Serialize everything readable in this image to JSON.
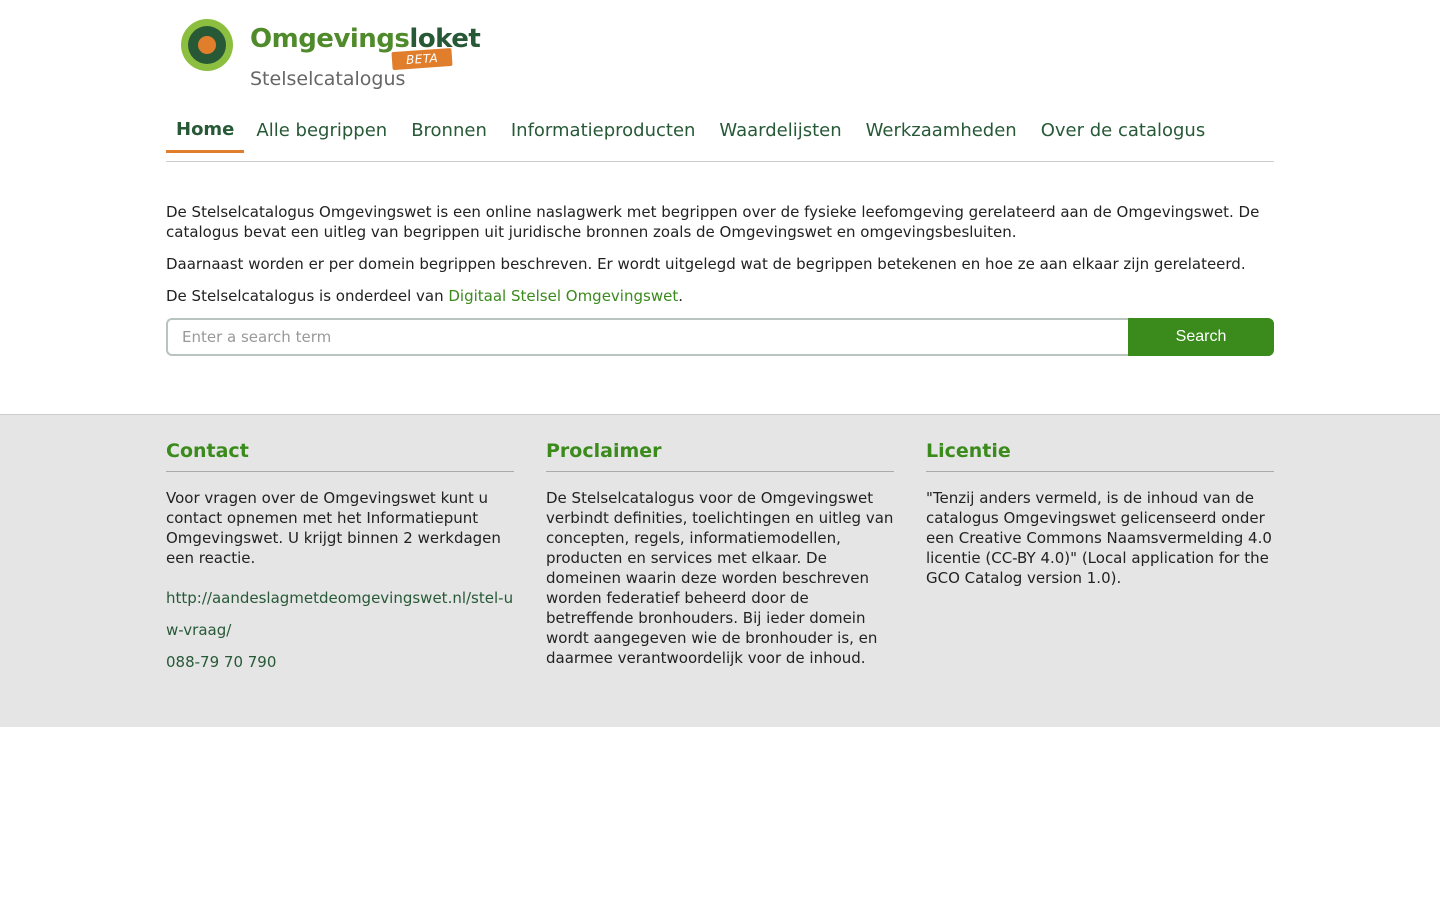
{
  "brand": {
    "name_part1": "Omgevings",
    "name_part2": "loket",
    "badge": "BETA",
    "subtitle": "Stelselcatalogus",
    "colors": {
      "green": "#4f8a2b",
      "dark_green": "#275937",
      "orange": "#e07e2b"
    }
  },
  "nav": {
    "items": [
      {
        "label": "Home",
        "active": true
      },
      {
        "label": "Alle begrippen"
      },
      {
        "label": "Bronnen"
      },
      {
        "label": "Informatieproducten"
      },
      {
        "label": "Waardelijsten"
      },
      {
        "label": "Werkzaamheden"
      },
      {
        "label": "Over de catalogus"
      }
    ]
  },
  "intro": {
    "p1": "De Stelselcatalogus Omgevingswet is een online naslagwerk met begrippen over de fysieke leefomgeving gerelateerd aan de Omgevingswet. De catalogus bevat een uitleg van begrippen uit juridische bronnen zoals de Omgevingswet en omgevingsbesluiten.",
    "p2": "Daarnaast worden er per domein begrippen beschreven. Er wordt uitgelegd wat de begrippen betekenen en hoe ze aan elkaar zijn gerelateerd.",
    "p3_prefix": "De Stelselcatalogus is onderdeel van ",
    "p3_link": "Digitaal Stelsel Omgevingswet",
    "p3_suffix": "."
  },
  "search": {
    "placeholder": "Enter a search term",
    "value": "",
    "button_label": "Search"
  },
  "footer": {
    "contact": {
      "title": "Contact",
      "text": "Voor vragen over de Omgevingswet kunt u contact opnemen met het Informatiepunt Omgevingswet. U krijgt binnen 2 werkdagen een reactie.",
      "link": "http://aandeslagmetdeomgevingswet.nl/stel-uw-vraag/",
      "phone": "088-79 70 790"
    },
    "proclaimer": {
      "title": "Proclaimer",
      "text": "De Stelselcatalogus voor de Omgevingswet verbindt definities, toelichtingen en uitleg van concepten, regels, informatiemodellen, producten en services met elkaar. De domeinen waarin deze worden beschreven worden federatief beheerd door de betreffende bronhouders. Bij ieder domein wordt aangegeven wie de bronhouder is, en daarmee verantwoordelijk voor de inhoud."
    },
    "licentie": {
      "title": "Licentie",
      "text": "\"Tenzij anders vermeld, is de inhoud van de catalogus Omgevingswet gelicenseerd onder een Creative Commons Naamsvermelding 4.0 licentie (CC-BY 4.0)\" (Local application for the GCO Catalog version 1.0)."
    }
  }
}
